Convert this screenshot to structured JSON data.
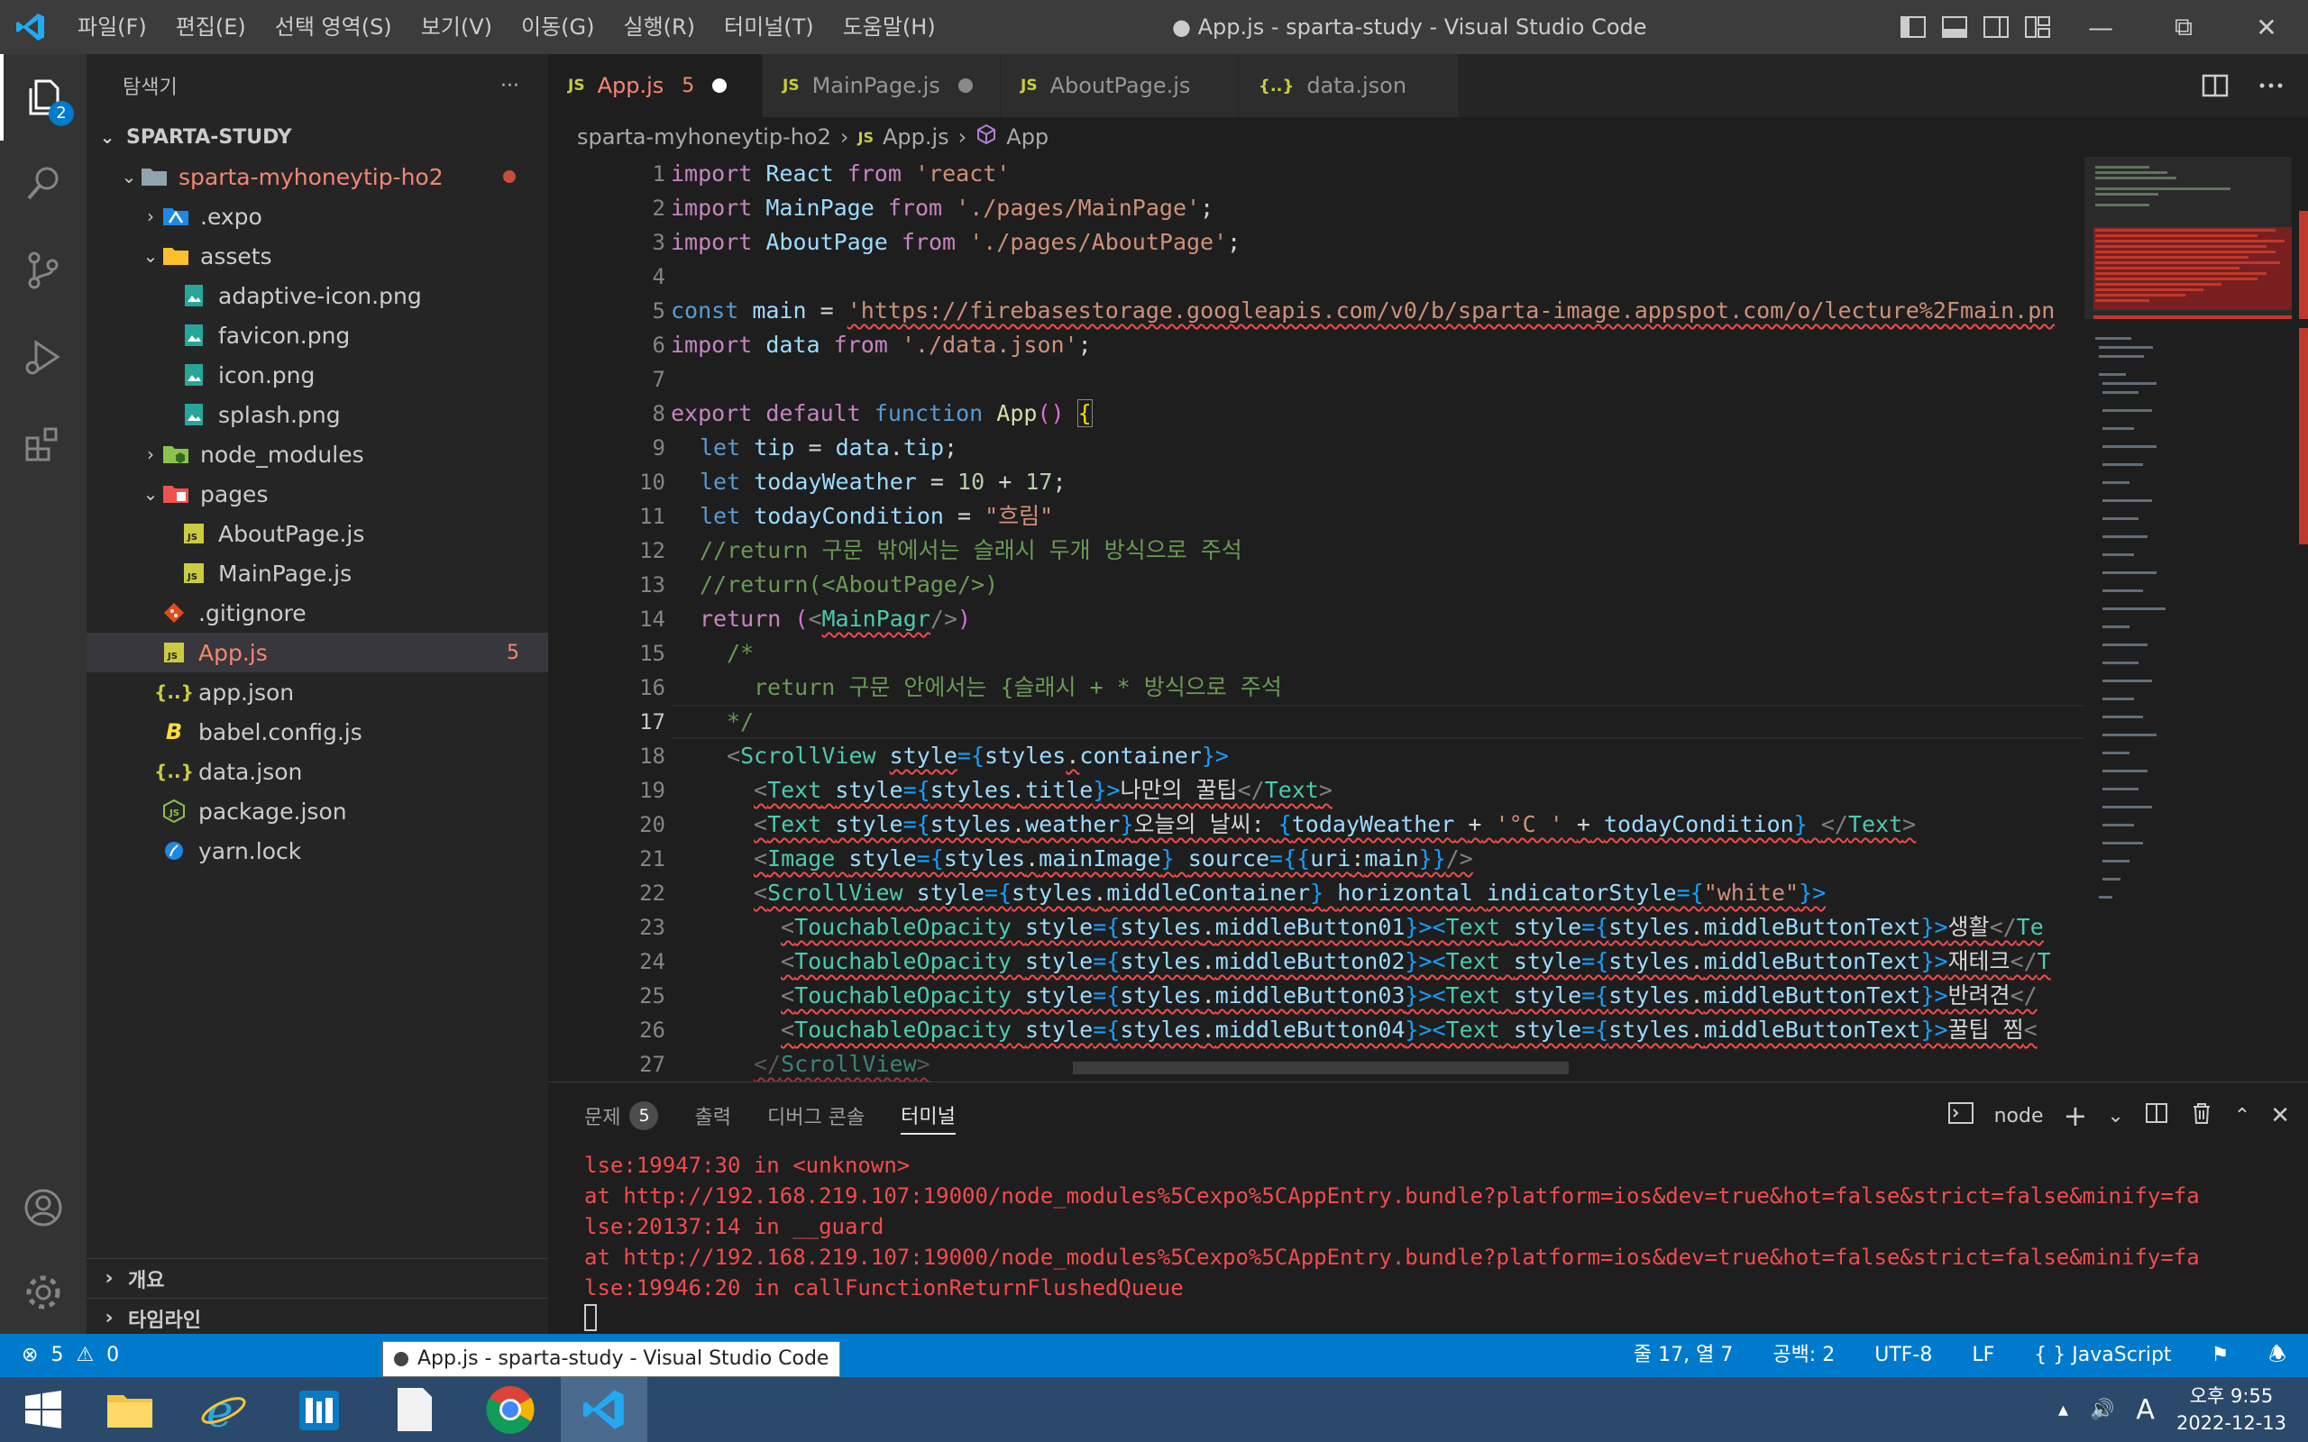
{
  "titlebar": {
    "menu": [
      "파일(F)",
      "편집(E)",
      "선택 영역(S)",
      "보기(V)",
      "이동(G)",
      "실행(R)",
      "터미널(T)",
      "도움말(H)"
    ],
    "window_title": "● App.js - sparta-study - Visual Studio Code"
  },
  "activity": {
    "explorer_badge": "2"
  },
  "sidebar": {
    "header": "탐색기",
    "more": "···",
    "root": "SPARTA-STUDY",
    "items": [
      {
        "label": "sparta-myhoneytip-ho2"
      },
      {
        "label": ".expo"
      },
      {
        "label": "assets"
      },
      {
        "label": "adaptive-icon.png"
      },
      {
        "label": "favicon.png"
      },
      {
        "label": "icon.png"
      },
      {
        "label": "splash.png"
      },
      {
        "label": "node_modules"
      },
      {
        "label": "pages"
      },
      {
        "label": "AboutPage.js"
      },
      {
        "label": "MainPage.js"
      },
      {
        "label": ".gitignore"
      },
      {
        "label": "App.js",
        "problems": "5"
      },
      {
        "label": "app.json"
      },
      {
        "label": "babel.config.js"
      },
      {
        "label": "data.json"
      },
      {
        "label": "package.json"
      },
      {
        "label": "yarn.lock"
      }
    ],
    "outline": "개요",
    "timeline": "타임라인"
  },
  "tabs": [
    {
      "label": "App.js",
      "problems": "5"
    },
    {
      "label": "MainPage.js"
    },
    {
      "label": "AboutPage.js"
    },
    {
      "label": "data.json"
    }
  ],
  "breadcrumb": {
    "folder": "sparta-myhoneytip-ho2",
    "file": "App.js",
    "symbol": "App"
  },
  "line_numbers": [
    "1",
    "2",
    "3",
    "4",
    "5",
    "6",
    "7",
    "8",
    "9",
    "10",
    "11",
    "12",
    "13",
    "14",
    "15",
    "16",
    "17",
    "18",
    "19",
    "20",
    "21",
    "22",
    "23",
    "24",
    "25",
    "26",
    "27"
  ],
  "code": {
    "l1": [
      "import",
      "React",
      "from",
      "'react'"
    ],
    "l2": [
      "import",
      "MainPage",
      "from",
      "'./pages/MainPage'",
      ";"
    ],
    "l3": [
      "import",
      "AboutPage",
      "from",
      "'./pages/AboutPage'",
      ";"
    ],
    "l5": [
      "const",
      "main",
      "=",
      "'https://firebasestorage.googleapis.com/v0/b/sparta-image.appspot.com/o/lecture%2Fmain.pn"
    ],
    "l6": [
      "import",
      "data",
      "from",
      "'./data.json'",
      ";"
    ],
    "l8": [
      "export",
      "default",
      "function",
      "App",
      "()",
      "{"
    ],
    "l9": [
      "let",
      "tip",
      "=",
      "data",
      ".",
      "tip",
      ";"
    ],
    "l10": [
      "let",
      "todayWeather",
      "=",
      "10",
      "+",
      "17",
      ";"
    ],
    "l11": [
      "let",
      "todayCondition",
      "=",
      "\"흐림\""
    ],
    "l12": "//return 구문 밖에서는 슬래시 두개 방식으로 주석",
    "l13": "//return(<AboutPage/>)",
    "l14": [
      "return",
      "(",
      "<",
      "MainPagr",
      "/>",
      ")"
    ],
    "l15": "/*",
    "l16": "return 구문 안에서는 {슬래시 + * 방식으로 주석",
    "l17": "*/",
    "l18": [
      "<",
      "ScrollView",
      "style",
      "={",
      "styles",
      ".",
      "container",
      "}>"
    ],
    "l19": [
      "<",
      "Text",
      "style",
      "={",
      "styles",
      ".",
      "title",
      "}>",
      "나만의 꿀팁",
      "</",
      "Text",
      ">"
    ],
    "l20": [
      "<",
      "Text",
      "style",
      "={",
      "styles",
      ".",
      "weather",
      "}>",
      "오늘의 날씨: ",
      "{",
      "todayWeather",
      "+",
      "'°C '",
      "+",
      "todayCondition",
      "}",
      "</",
      "Text",
      ">"
    ],
    "l21": [
      "<",
      "Image",
      "style",
      "={",
      "styles",
      ".",
      "mainImage",
      "}",
      "source",
      "={{",
      "uri",
      ":",
      "main",
      "}}",
      "/>"
    ],
    "l22": [
      "<",
      "ScrollView",
      "style",
      "={",
      "styles",
      ".",
      "middleContainer",
      "}",
      "horizontal",
      "indicatorStyle",
      "={",
      "\"white\"",
      "}>"
    ],
    "l23": [
      "<",
      "TouchableOpacity",
      "style",
      "={",
      "styles",
      ".",
      "middleButton01",
      "}><",
      "Text",
      "style",
      "={",
      "styles",
      ".",
      "middleButtonText",
      "}>",
      "생활",
      "</",
      "Te"
    ],
    "l24": [
      "<",
      "TouchableOpacity",
      "style",
      "={",
      "styles",
      ".",
      "middleButton02",
      "}><",
      "Text",
      "style",
      "={",
      "styles",
      ".",
      "middleButtonText",
      "}>",
      "재테크",
      "</",
      "T"
    ],
    "l25": [
      "<",
      "TouchableOpacity",
      "style",
      "={",
      "styles",
      ".",
      "middleButton03",
      "}><",
      "Text",
      "style",
      "={",
      "styles",
      ".",
      "middleButtonText",
      "}>",
      "반려견",
      "</",
      ""
    ],
    "l26": [
      "<",
      "TouchableOpacity",
      "style",
      "={",
      "styles",
      ".",
      "middleButton04",
      "}><",
      "Text",
      "style",
      "={",
      "styles",
      ".",
      "middleButtonText",
      "}>",
      "꿀팁 찜",
      "<"
    ],
    "l27": [
      "</",
      "ScrollView",
      ">"
    ]
  },
  "panel": {
    "tabs": [
      "문제",
      "출력",
      "디버그 콘솔",
      "터미널"
    ],
    "problems_count": "5",
    "terminal_name": "node",
    "lines": [
      "lse:19947:30 in <unknown>",
      "at http://192.168.219.107:19000/node_modules%5Cexpo%5CAppEntry.bundle?platform=ios&dev=true&hot=false&strict=false&minify=fa",
      "lse:20137:14 in __guard",
      "at http://192.168.219.107:19000/node_modules%5Cexpo%5CAppEntry.bundle?platform=ios&dev=true&hot=false&strict=false&minify=fa",
      "lse:19946:20 in callFunctionReturnFlushedQueue"
    ]
  },
  "status": {
    "errors": "5",
    "warnings": "0",
    "position": "줄 17, 열 7",
    "spaces": "공백: 2",
    "encoding": "UTF-8",
    "eol": "LF",
    "language": "JavaScript",
    "tooltip": "App.js - sparta-study - Visual Studio Code"
  },
  "taskbar": {
    "time": "오후 9:55",
    "date": "2022-12-13",
    "ime": "A"
  },
  "colors": {
    "accent": "#007acc",
    "error": "#f14c4c",
    "titlebar": "#3c3c3c",
    "sidebar": "#252526",
    "editor": "#1e1e1e"
  }
}
